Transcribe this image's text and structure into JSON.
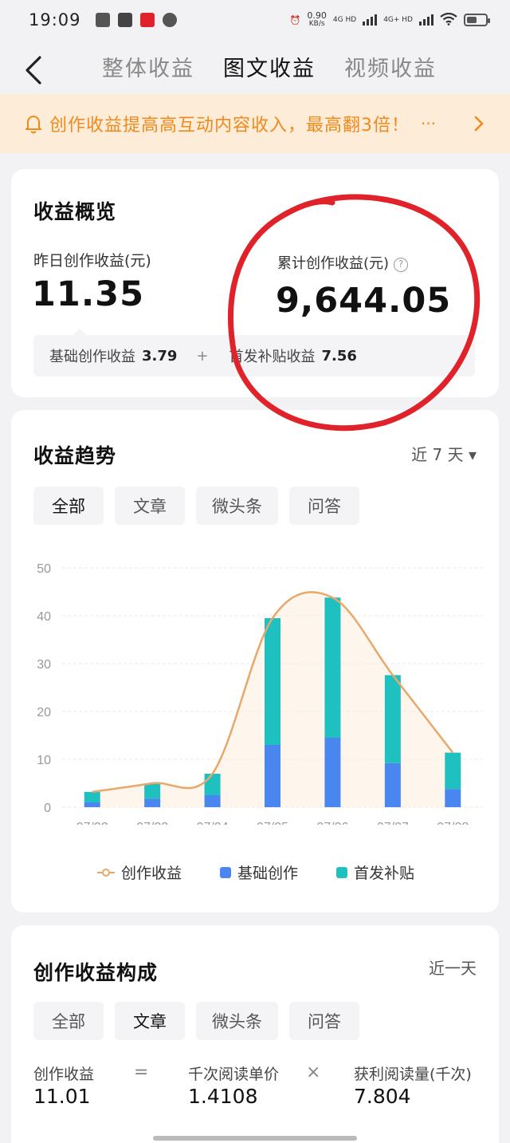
{
  "status": {
    "time": "19:09",
    "speed": "0.90",
    "speed_unit": "KB/s",
    "net1": "4G HD",
    "net2": "4G+ HD"
  },
  "nav": {
    "tabs": [
      "整体收益",
      "图文收益",
      "视频收益"
    ],
    "active": 1
  },
  "banner": {
    "text": "创作收益提高高互动内容收入，最高翻3倍！",
    "more": "···",
    "chevron": "›"
  },
  "overview": {
    "title": "收益概览",
    "yesterday_label": "昨日创作收益(元)",
    "yesterday_value": "11.35",
    "total_label": "累计创作收益(元)",
    "total_value": "9,644.05",
    "help": "?",
    "basic_label": "基础创作收益",
    "basic_value": "3.79",
    "plus": "+",
    "subsidy_label": "首发补贴收益",
    "subsidy_value": "7.56"
  },
  "trend": {
    "title": "收益趋势",
    "range": "近 7 天 ▾",
    "filters": [
      "全部",
      "文章",
      "微头条",
      "问答"
    ],
    "active_filter": 0
  },
  "chart_data": {
    "type": "bar",
    "categories": [
      "07/22",
      "07/23",
      "07/24",
      "07/25",
      "07/26",
      "07/27",
      "07/28"
    ],
    "ylim": [
      0,
      50
    ],
    "yticks": [
      0,
      10,
      20,
      30,
      40,
      50
    ],
    "grid": true,
    "legend_position": "bottom",
    "stacked": true,
    "series": [
      {
        "name": "基础创作",
        "type": "bar",
        "color": "#4a86f0",
        "values": [
          1.0,
          1.8,
          2.5,
          13.0,
          14.5,
          9.2,
          3.8
        ]
      },
      {
        "name": "首发补贴",
        "type": "bar",
        "color": "#1ec1c0",
        "values": [
          2.2,
          3.2,
          4.5,
          26.5,
          29.3,
          18.4,
          7.6
        ]
      },
      {
        "name": "创作收益",
        "type": "line",
        "color": "#e8a86a",
        "values": [
          3.2,
          5.0,
          7.0,
          39.5,
          43.8,
          27.6,
          11.4
        ]
      }
    ]
  },
  "composition": {
    "title": "创作收益构成",
    "range": "近一天",
    "filters": [
      "全部",
      "文章",
      "微头条",
      "问答"
    ],
    "active_filter": 1,
    "earn_label": "创作收益",
    "earn_value": "11.01",
    "equals": "=",
    "price_label": "千次阅读单价",
    "price_value": "1.4108",
    "times": "×",
    "reads_label": "获利阅读量(千次)",
    "reads_value": "7.804"
  },
  "colors": {
    "accent_orange": "#f08a1c",
    "annotation_red": "#e0222a"
  }
}
